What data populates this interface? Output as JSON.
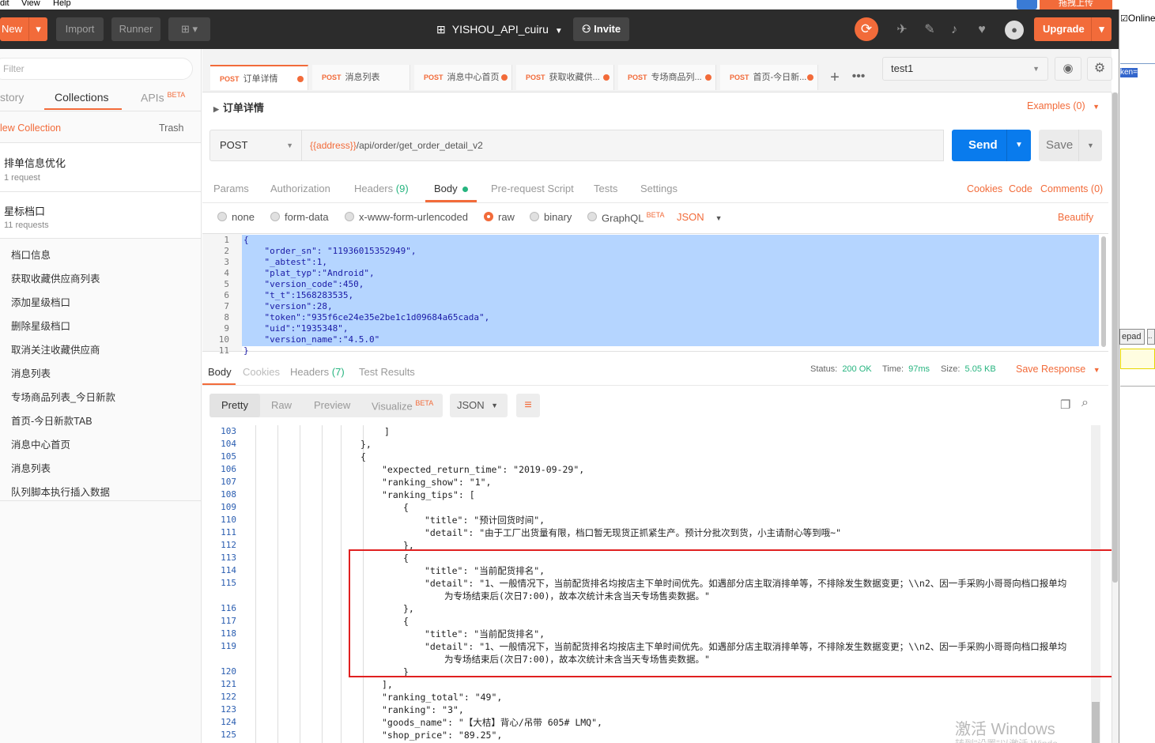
{
  "menu": {
    "items": [
      "dit",
      "View",
      "Help"
    ],
    "upload_btn": "拖拽上传"
  },
  "header": {
    "new": "New",
    "import": "Import",
    "runner": "Runner",
    "workspace": "YISHOU_API_cuiru",
    "invite": "Invite",
    "upgrade": "Upgrade"
  },
  "sidebar": {
    "filter_placeholder": "Filter",
    "tabs": [
      "story",
      "Collections",
      "APIs"
    ],
    "apis_beta": "BETA",
    "new_collection": "lew Collection",
    "trash": "Trash",
    "collections": [
      {
        "name": "排单信息优化",
        "count": "1 request"
      },
      {
        "name": "星标档口",
        "count": "11 requests"
      }
    ],
    "requests": [
      "档口信息",
      "获取收藏供应商列表",
      "添加星级档口",
      "删除星级档口",
      "取消关注收藏供应商",
      "消息列表",
      "专场商品列表_今日新款",
      "首页-今日新款TAB",
      "消息中心首页",
      "消息列表",
      "队列脚本执行插入数据"
    ]
  },
  "tabs": [
    {
      "method": "POST",
      "name": "订单详情"
    },
    {
      "method": "POST",
      "name": "消息列表"
    },
    {
      "method": "POST",
      "name": "消息中心首页"
    },
    {
      "method": "POST",
      "name": "获取收藏供..."
    },
    {
      "method": "POST",
      "name": "专场商品列..."
    },
    {
      "method": "POST",
      "name": "首页-今日新..."
    }
  ],
  "environment": "test1",
  "request": {
    "title": "订单详情",
    "examples": "Examples (0)",
    "method": "POST",
    "url_var": "{{address}}",
    "url_path": "/api/order/get_order_detail_v2",
    "send": "Send",
    "save": "Save"
  },
  "req_tabs": {
    "params": "Params",
    "authorization": "Authorization",
    "headers": "Headers",
    "headers_count": "(9)",
    "body": "Body",
    "prerequest": "Pre-request Script",
    "tests": "Tests",
    "settings": "Settings",
    "cookies": "Cookies",
    "code": "Code",
    "comments": "Comments (0)"
  },
  "body_types": {
    "none": "none",
    "form_data": "form-data",
    "urlencoded": "x-www-form-urlencoded",
    "raw": "raw",
    "binary": "binary",
    "graphql": "GraphQL",
    "graphql_beta": "BETA",
    "format": "JSON",
    "beautify": "Beautify"
  },
  "request_body": {
    "line_numbers": [
      "1",
      "2",
      "3",
      "4",
      "5",
      "6",
      "7",
      "8",
      "9",
      "10",
      "11"
    ],
    "lines": [
      "{",
      "    \"order_sn\": \"11936015352949\",",
      "    \"_abtest\":1,",
      "    \"plat_typ\":\"Android\",",
      "    \"version_code\":450,",
      "    \"t_t\":1568283535,",
      "    \"version\":28,",
      "    \"token\":\"935f6ce24e35e2be1c1d09684a65cada\",",
      "    \"uid\":\"1935348\",",
      "    \"version_name\":\"4.5.0\"",
      "}"
    ]
  },
  "response": {
    "tabs": {
      "body": "Body",
      "cookies": "Cookies",
      "headers": "Headers",
      "headers_count": "(7)",
      "tests": "Test Results"
    },
    "status_label": "Status:",
    "status": "200 OK",
    "time_label": "Time:",
    "time": "97ms",
    "size_label": "Size:",
    "size": "5.05 KB",
    "save_response": "Save Response",
    "views": {
      "pretty": "Pretty",
      "raw": "Raw",
      "preview": "Preview",
      "visualize": "Visualize",
      "visualize_beta": "BETA",
      "format": "JSON"
    }
  },
  "response_body": [
    {
      "n": "103",
      "t": "]"
    },
    {
      "n": "104",
      "t": "},"
    },
    {
      "n": "105",
      "t": "{"
    },
    {
      "n": "106",
      "t": "\"expected_return_time\": \"2019-09-29\","
    },
    {
      "n": "107",
      "t": "\"ranking_show\": \"1\","
    },
    {
      "n": "108",
      "t": "\"ranking_tips\": ["
    },
    {
      "n": "109",
      "t": "{"
    },
    {
      "n": "110",
      "t": "\"title\": \"预计回货时间\","
    },
    {
      "n": "111",
      "t": "\"detail\": \"由于工厂出货量有限，档口暂无现货正抓紧生产。预计分批次到货，小主请耐心等到哦~\""
    },
    {
      "n": "112",
      "t": "},"
    },
    {
      "n": "113",
      "t": "{"
    },
    {
      "n": "114",
      "t": "\"title\": \"当前配货排名\","
    },
    {
      "n": "115",
      "t": "\"detail\": \"1、一般情况下，当前配货排名均按店主下单时间优先。如遇部分店主取消排单等，不排除发生数据变更；\\\\n2、因一手采购小哥哥向档口报单均"
    },
    {
      "n": "",
      "t": "为专场结束后(次日7:00)，故本次统计未含当天专场售卖数据。\""
    },
    {
      "n": "116",
      "t": "},"
    },
    {
      "n": "117",
      "t": "{"
    },
    {
      "n": "118",
      "t": "\"title\": \"当前配货排名\","
    },
    {
      "n": "119",
      "t": "\"detail\": \"1、一般情况下，当前配货排名均按店主下单时间优先。如遇部分店主取消排单等，不排除发生数据变更；\\\\n2、因一手采购小哥哥向档口报单均"
    },
    {
      "n": "",
      "t": "为专场结束后(次日7:00)，故本次统计未含当天专场售卖数据。\""
    },
    {
      "n": "120",
      "t": "}"
    },
    {
      "n": "121",
      "t": "],"
    },
    {
      "n": "122",
      "t": "\"ranking_total\": \"49\","
    },
    {
      "n": "123",
      "t": "\"ranking\": \"3\","
    },
    {
      "n": "124",
      "t": "\"goods_name\": \"【大桔】背心/吊带 605# LMQ\","
    },
    {
      "n": "125",
      "t": "\"shop_price\": \"89.25\","
    }
  ],
  "right_panel": {
    "online": "Online",
    "token_fragment": "ken=",
    "notepad": "epad",
    "dot": ".."
  },
  "watermark": {
    "line1": "激活 Windows",
    "line2": "转到\"设置\"以激活 Windo"
  },
  "colors": {
    "accent": "#f26b3a",
    "send": "#097bed",
    "highlight": "#b5d5ff",
    "annotation_box": "#e02020"
  }
}
